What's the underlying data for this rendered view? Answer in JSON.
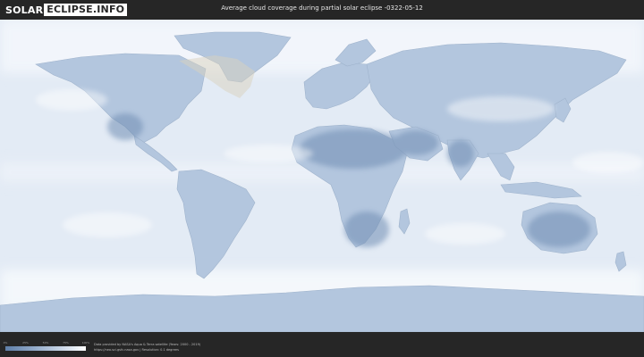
{
  "header": {
    "logo_left": "SOLAR",
    "logo_right": "ECLIPSE.INFO",
    "title": "Average cloud coverage during partial solar eclipse -0322-05-12"
  },
  "map": {
    "ocean_color": "#e3ebf5",
    "land_color": "#b3c6de",
    "clear_sky_color": "#6f8db3",
    "cloud_color": "#f4f7fb",
    "eclipse_zone_color": "#d9d2bd"
  },
  "legend": {
    "ticks": [
      "0%",
      "25%",
      "50%",
      "75%",
      "100%"
    ],
    "gradient": [
      "#5f7fa8",
      "#8ea6c6",
      "#c4d2e4",
      "#ffffff"
    ]
  },
  "footer": {
    "credit_line1": "Data provided by NASA's Aqua & Terra satellite (Years: 2000 - 2019)",
    "credit_line2": "https://neo.sci.gsfc.nasa.gov | Resolution: 0.1 degrees"
  }
}
